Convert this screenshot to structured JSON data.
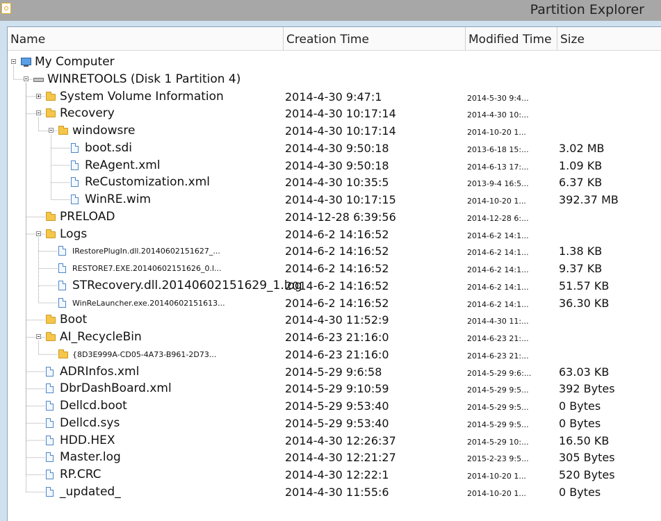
{
  "window": {
    "title": "Partition Explorer"
  },
  "columns": {
    "name": "Name",
    "creation_time": "Creation Time",
    "modified_time": "Modified Time",
    "size": "Size"
  },
  "rows": [
    {
      "name": "My Computer",
      "ctime": "",
      "mtime": "",
      "size": "",
      "level": 0,
      "icon": "computer-icon",
      "toggle": "minus",
      "small": false
    },
    {
      "name": "WINRETOOLS (Disk 1 Partition 4)",
      "ctime": "",
      "mtime": "",
      "size": "",
      "level": 1,
      "icon": "disk-icon",
      "toggle": "minus",
      "small": false
    },
    {
      "name": "System Volume Information",
      "ctime": "2014-4-30 9:47:1",
      "mtime": "2014-5-30 9:4...",
      "size": "",
      "level": 2,
      "icon": "folder-icon",
      "toggle": "plus",
      "small": false
    },
    {
      "name": "Recovery",
      "ctime": "2014-4-30 10:17:14",
      "mtime": "2014-4-30 10:...",
      "size": "",
      "level": 2,
      "icon": "folder-icon",
      "toggle": "minus",
      "small": false
    },
    {
      "name": "windowsre",
      "ctime": "2014-4-30 10:17:14",
      "mtime": "2014-10-20 1...",
      "size": "",
      "level": 3,
      "icon": "folder-icon",
      "toggle": "minus",
      "small": false
    },
    {
      "name": "boot.sdi",
      "ctime": "2014-4-30 9:50:18",
      "mtime": "2013-6-18 15:...",
      "size": "3.02 MB",
      "level": 4,
      "icon": "file-icon",
      "toggle": "",
      "small": false
    },
    {
      "name": "ReAgent.xml",
      "ctime": "2014-4-30 9:50:18",
      "mtime": "2014-6-13 17:...",
      "size": "1.09 KB",
      "level": 4,
      "icon": "file-icon",
      "toggle": "",
      "small": false
    },
    {
      "name": "ReCustomization.xml",
      "ctime": "2014-4-30 10:35:5",
      "mtime": "2013-9-4 16:5...",
      "size": "6.37 KB",
      "level": 4,
      "icon": "file-icon",
      "toggle": "",
      "small": false
    },
    {
      "name": "WinRE.wim",
      "ctime": "2014-4-30 10:17:15",
      "mtime": "2014-10-20 1...",
      "size": "392.37 MB",
      "level": 4,
      "icon": "file-icon",
      "toggle": "",
      "small": false
    },
    {
      "name": "PRELOAD",
      "ctime": "2014-12-28 6:39:56",
      "mtime": "2014-12-28 6:...",
      "size": "",
      "level": 2,
      "icon": "folder-icon",
      "toggle": "",
      "small": false
    },
    {
      "name": "Logs",
      "ctime": "2014-6-2 14:16:52",
      "mtime": "2014-6-2 14:1...",
      "size": "",
      "level": 2,
      "icon": "folder-icon",
      "toggle": "minus",
      "small": false
    },
    {
      "name": "IRestorePlugIn.dll.20140602151627_...",
      "ctime": "2014-6-2 14:16:52",
      "mtime": "2014-6-2 14:1...",
      "size": "1.38 KB",
      "level": 3,
      "icon": "file-icon",
      "toggle": "",
      "small": true
    },
    {
      "name": "RESTORE7.EXE.20140602151626_0.l...",
      "ctime": "2014-6-2 14:16:52",
      "mtime": "2014-6-2 14:1...",
      "size": "9.37 KB",
      "level": 3,
      "icon": "file-icon",
      "toggle": "",
      "small": true
    },
    {
      "name": "STRecovery.dll.20140602151629_1.log",
      "ctime": "2014-6-2 14:16:52",
      "mtime": "2014-6-2 14:1...",
      "size": "51.57 KB",
      "level": 3,
      "icon": "file-icon",
      "toggle": "",
      "small": false
    },
    {
      "name": "WinReLauncher.exe.20140602151613...",
      "ctime": "2014-6-2 14:16:52",
      "mtime": "2014-6-2 14:1...",
      "size": "36.30 KB",
      "level": 3,
      "icon": "file-icon",
      "toggle": "",
      "small": true
    },
    {
      "name": "Boot",
      "ctime": "2014-4-30 11:52:9",
      "mtime": "2014-4-30 11:...",
      "size": "",
      "level": 2,
      "icon": "folder-icon",
      "toggle": "",
      "small": false
    },
    {
      "name": "AI_RecycleBin",
      "ctime": "2014-6-23 21:16:0",
      "mtime": "2014-6-23 21:...",
      "size": "",
      "level": 2,
      "icon": "folder-icon",
      "toggle": "minus",
      "small": false
    },
    {
      "name": "{8D3E999A-CD05-4A73-B961-2D73...",
      "ctime": "2014-6-23 21:16:0",
      "mtime": "2014-6-23 21:...",
      "size": "",
      "level": 3,
      "icon": "folder-icon",
      "toggle": "",
      "small": true
    },
    {
      "name": "ADRInfos.xml",
      "ctime": "2014-5-29 9:6:58",
      "mtime": "2014-5-29 9:6:...",
      "size": "63.03 KB",
      "level": 2,
      "icon": "file-icon",
      "toggle": "",
      "small": false
    },
    {
      "name": "DbrDashBoard.xml",
      "ctime": "2014-5-29 9:10:59",
      "mtime": "2014-5-29 9:5...",
      "size": "392 Bytes",
      "level": 2,
      "icon": "file-icon",
      "toggle": "",
      "small": false
    },
    {
      "name": "Dellcd.boot",
      "ctime": "2014-5-29 9:53:40",
      "mtime": "2014-5-29 9:5...",
      "size": "0 Bytes",
      "level": 2,
      "icon": "file-icon",
      "toggle": "",
      "small": false
    },
    {
      "name": "Dellcd.sys",
      "ctime": "2014-5-29 9:53:40",
      "mtime": "2014-5-29 9:5...",
      "size": "0 Bytes",
      "level": 2,
      "icon": "file-icon",
      "toggle": "",
      "small": false
    },
    {
      "name": "HDD.HEX",
      "ctime": "2014-4-30 12:26:37",
      "mtime": "2014-5-29 10:...",
      "size": "16.50 KB",
      "level": 2,
      "icon": "file-icon",
      "toggle": "",
      "small": false
    },
    {
      "name": "Master.log",
      "ctime": "2014-4-30 12:21:27",
      "mtime": "2015-2-23 9:5...",
      "size": "305 Bytes",
      "level": 2,
      "icon": "file-icon",
      "toggle": "",
      "small": false
    },
    {
      "name": "RP.CRC",
      "ctime": "2014-4-30 12:22:1",
      "mtime": "2014-10-20 1...",
      "size": "520 Bytes",
      "level": 2,
      "icon": "file-icon",
      "toggle": "",
      "small": false
    },
    {
      "name": "_updated_",
      "ctime": "2014-4-30 11:55:6",
      "mtime": "2014-10-20 1...",
      "size": "0 Bytes",
      "level": 2,
      "icon": "file-icon",
      "toggle": "",
      "small": false
    }
  ]
}
